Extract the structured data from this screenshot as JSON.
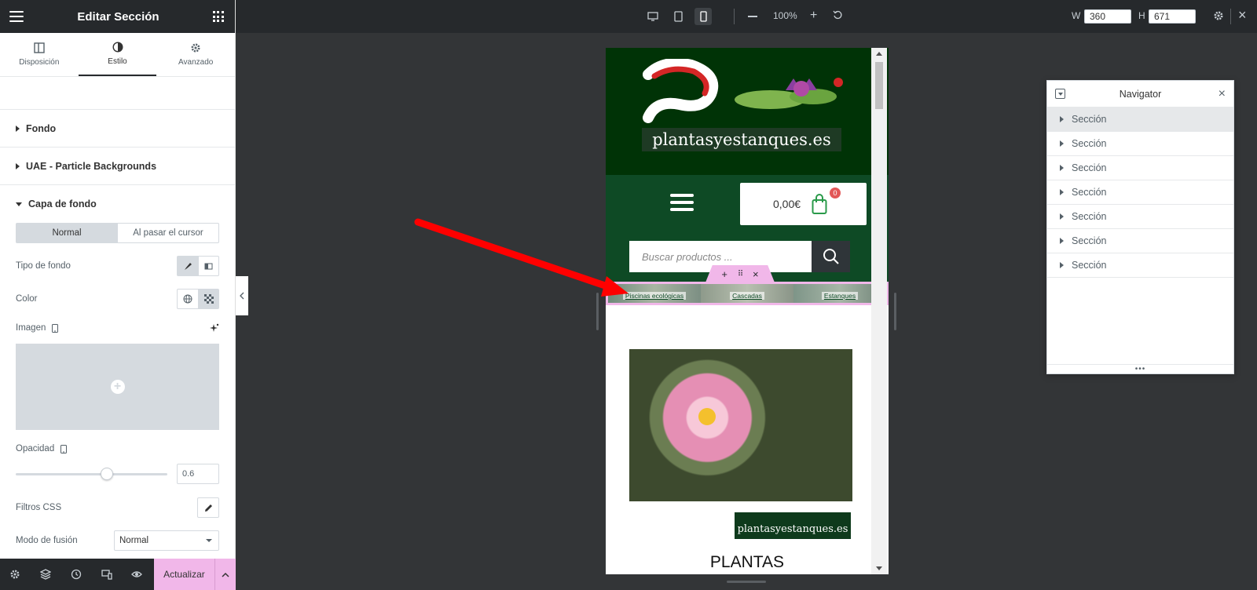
{
  "panel": {
    "title": "Editar Sección",
    "tabs": [
      {
        "label": "Disposición",
        "active": false
      },
      {
        "label": "Estilo",
        "active": true
      },
      {
        "label": "Avanzado",
        "active": false
      }
    ],
    "accordions": [
      "Fondo",
      "UAE - Particle Backgrounds"
    ],
    "open_section": "Capa de fondo",
    "state_tabs": {
      "normal": "Normal",
      "hover": "Al pasar el cursor"
    },
    "controls": {
      "bg_type": "Tipo de fondo",
      "color": "Color",
      "image": "Imagen",
      "opacity": "Opacidad",
      "opacity_value": "0.6",
      "opacity_fraction": 0.6,
      "css_filters": "Filtros CSS",
      "blend_mode": "Modo de fusión",
      "blend_value": "Normal"
    },
    "footer": {
      "publish": "Actualizar"
    }
  },
  "topbar": {
    "zoom": "100%",
    "width_label": "W",
    "width": "360",
    "height_label": "H",
    "height": "671"
  },
  "preview": {
    "site_name": "plantasyestanques.es",
    "cart_amount": "0,00€",
    "cart_count": "0",
    "search_placeholder": "Buscar productos ...",
    "menu_strip": [
      "Piscinas ecológicas",
      "Cascadas",
      "Estanques"
    ],
    "logo_small": "plantasyestanques.es",
    "heading": "PLANTAS"
  },
  "navigator": {
    "title": "Navigator",
    "items": [
      "Sección",
      "Sección",
      "Sección",
      "Sección",
      "Sección",
      "Sección",
      "Sección"
    ]
  },
  "colors": {
    "accent_pink": "#f1b7e9",
    "dark_ui": "#26292c",
    "site_dark_green": "#003306",
    "site_green": "#0e4a25",
    "arrow_red": "#ff0000"
  }
}
